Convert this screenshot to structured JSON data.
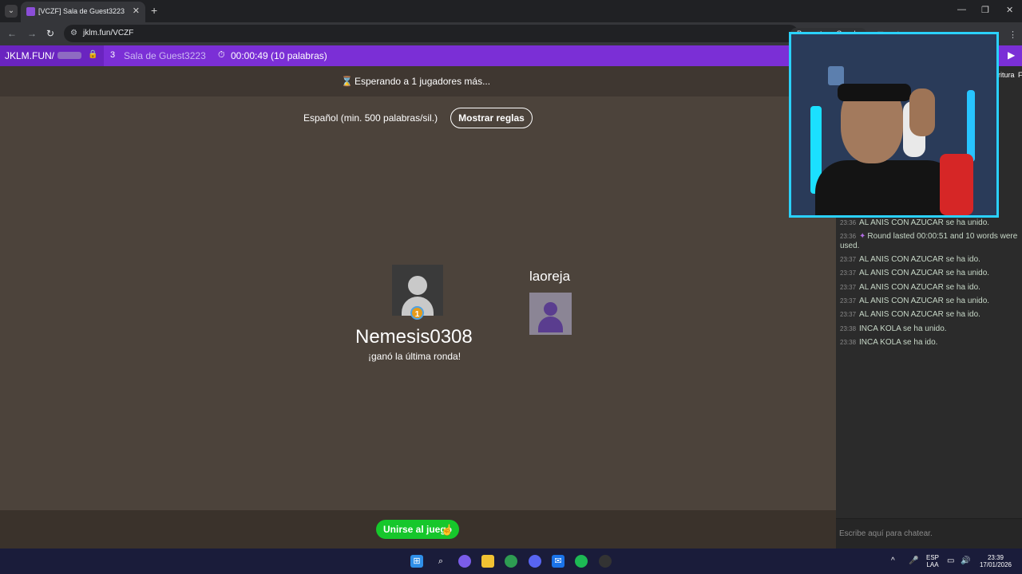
{
  "browser": {
    "tab_title": "[VCZF] Sala de Guest3223",
    "url": "jklm.fun/VCZF",
    "ask_google": "Preguntar a Google"
  },
  "header": {
    "brand": "JKLM.FUN/",
    "players_count": "3",
    "room_name": "Sala de Guest3223",
    "timer": "00:00:49 (10 palabras)"
  },
  "game": {
    "status": "Esperando a 1 jugadores más...",
    "dictionary": "Español (min. 500 palabras/sil.)",
    "rules_button": "Mostrar reglas",
    "player1": {
      "name": "Nemesis0308",
      "medal": "1",
      "subtitle": "¡ganó la última ronda!"
    },
    "player2": {
      "name": "laoreja"
    },
    "join_button": "Unirse al juego"
  },
  "chat": {
    "side_label": "ritura",
    "side_label_2": "F",
    "messages": [
      {
        "time": "23:36",
        "text": "AL ANIS CON AZUCAR se ha unido."
      },
      {
        "time": "23:36",
        "text": "Round lasted 00:00:51 and 10 words were used."
      },
      {
        "time": "23:37",
        "text": "AL ANIS CON AZUCAR se ha ido."
      },
      {
        "time": "23:37",
        "text": "AL ANIS CON AZUCAR se ha unido."
      },
      {
        "time": "23:37",
        "text": "AL ANIS CON AZUCAR se ha ido."
      },
      {
        "time": "23:37",
        "text": "AL ANIS CON AZUCAR se ha unido."
      },
      {
        "time": "23:37",
        "text": "AL ANIS CON AZUCAR se ha ido."
      },
      {
        "time": "23:38",
        "text": "INCA KOLA se ha unido."
      },
      {
        "time": "23:38",
        "text": "INCA KOLA se ha ido."
      }
    ],
    "input_placeholder": "Escribe aquí para chatear."
  },
  "taskbar": {
    "lang_top": "ESP",
    "lang_bottom": "LAA",
    "time": "23:39",
    "date": "17/01/2026"
  },
  "colors": {
    "header_purple": "#7b2fd6",
    "join_green": "#16c72b",
    "webcam_border": "#2ad1ff"
  }
}
